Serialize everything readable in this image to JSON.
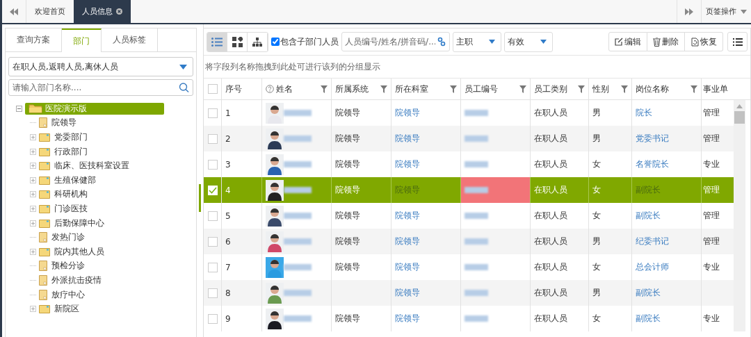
{
  "page_tabs": [
    {
      "label": "欢迎首页",
      "selected": false,
      "closable": false
    },
    {
      "label": "人员信息",
      "selected": true,
      "closable": true
    }
  ],
  "tab_actions": "页签操作",
  "left_panel": {
    "tabs": [
      {
        "label": "查询方案",
        "selected": false
      },
      {
        "label": "部门",
        "selected": true
      },
      {
        "label": "人员标签",
        "selected": false
      }
    ],
    "status_filter": "在职人员,返聘人员,离休人员",
    "search": {
      "placeholder": "请输入部门名称...."
    },
    "tree": [
      {
        "label": "医院演示版",
        "kind": "folder",
        "expanded": true,
        "selected": true,
        "children": [
          {
            "label": "院领导",
            "kind": "leaf",
            "selected": false
          },
          {
            "label": "党委部门",
            "kind": "folder",
            "expanded": false,
            "selected": false
          },
          {
            "label": "行政部门",
            "kind": "folder",
            "expanded": false,
            "selected": false
          },
          {
            "label": "临床、医技科室设置",
            "kind": "folder",
            "expanded": false,
            "selected": false
          },
          {
            "label": "生殖保健部",
            "kind": "folder",
            "expanded": false,
            "selected": false
          },
          {
            "label": "科研机构",
            "kind": "folder",
            "expanded": false,
            "selected": false
          },
          {
            "label": "门诊医技",
            "kind": "folder",
            "expanded": false,
            "selected": false
          },
          {
            "label": "后勤保障中心",
            "kind": "folder",
            "expanded": false,
            "selected": false
          },
          {
            "label": "发热门诊",
            "kind": "leaf",
            "selected": false
          },
          {
            "label": "院内其他人员",
            "kind": "folder",
            "expanded": false,
            "selected": false
          },
          {
            "label": "预检分诊",
            "kind": "leaf",
            "selected": false
          },
          {
            "label": "外派抗击疫情",
            "kind": "leaf",
            "selected": false
          },
          {
            "label": "放疗中心",
            "kind": "leaf",
            "selected": false
          },
          {
            "label": "新院区",
            "kind": "folder",
            "expanded": false,
            "selected": false
          }
        ]
      }
    ]
  },
  "toolbar": {
    "views": [
      {
        "kind": "list",
        "selected": true
      },
      {
        "kind": "cards",
        "selected": false
      },
      {
        "kind": "org",
        "selected": false
      }
    ],
    "include_sub": {
      "label": "包含子部门人员",
      "checked": true
    },
    "search": {
      "placeholder": "人员编号/姓名/拼音码/..."
    },
    "position_filter": "主职",
    "validity_filter": "有效",
    "buttons": [
      {
        "kind": "edit",
        "label": "编辑"
      },
      {
        "kind": "delete",
        "label": "删除"
      },
      {
        "kind": "restore",
        "label": "恢复"
      }
    ]
  },
  "group_hint": "将字段列名称拖拽到此处可进行该列的分组显示",
  "table": {
    "columns": [
      {
        "label": "序号",
        "filter": false,
        "help": false
      },
      {
        "label": "姓名",
        "filter": true,
        "help": true
      },
      {
        "label": "所属系统",
        "filter": true,
        "help": false
      },
      {
        "label": "所在科室",
        "filter": true,
        "help": false
      },
      {
        "label": "员工编号",
        "filter": true,
        "help": false
      },
      {
        "label": "员工类别",
        "filter": true,
        "help": false
      },
      {
        "label": "性别",
        "filter": true,
        "help": false
      },
      {
        "label": "岗位名称",
        "filter": true,
        "help": false
      },
      {
        "label": "事业单",
        "filter": false,
        "help": false
      }
    ],
    "select_all": false,
    "rows": [
      {
        "no": "1",
        "system": "院领导",
        "dept": "院领导",
        "type": "在职人员",
        "gender": "男",
        "post": "院长",
        "unit": "管理",
        "checked": false,
        "selected": false,
        "cell_flagged": false
      },
      {
        "no": "2",
        "system": "院领导",
        "dept": "院领导",
        "type": "在职人员",
        "gender": "男",
        "post": "党委书记",
        "unit": "管理",
        "checked": false,
        "selected": false,
        "cell_flagged": false
      },
      {
        "no": "3",
        "system": "院领导",
        "dept": "院领导",
        "type": "在职人员",
        "gender": "女",
        "post": "名誉院长",
        "unit": "专业",
        "checked": false,
        "selected": false,
        "cell_flagged": false
      },
      {
        "no": "4",
        "system": "院领导",
        "dept": "院领导",
        "type": "在职人员",
        "gender": "女",
        "post": "副院长",
        "unit": "管理",
        "checked": true,
        "selected": true,
        "cell_flagged": true
      },
      {
        "no": "5",
        "system": "院领导",
        "dept": "院领导",
        "type": "在职人员",
        "gender": "女",
        "post": "副院长",
        "unit": "管理",
        "checked": false,
        "selected": false,
        "cell_flagged": false
      },
      {
        "no": "6",
        "system": "院领导",
        "dept": "院领导",
        "type": "在职人员",
        "gender": "男",
        "post": "纪委书记",
        "unit": "管理",
        "checked": false,
        "selected": false,
        "cell_flagged": false
      },
      {
        "no": "7",
        "system": "院领导",
        "dept": "院领导",
        "type": "在职人员",
        "gender": "女",
        "post": "总会计师",
        "unit": "专业",
        "checked": false,
        "selected": false,
        "cell_flagged": false
      },
      {
        "no": "8",
        "dept": "院领导",
        "type": "在职人员",
        "gender": "男",
        "post": "副院长",
        "checked": false,
        "selected": false,
        "cell_flagged": false
      },
      {
        "no": "9",
        "system": "院领导",
        "dept": "院领导",
        "type": "在职人员",
        "gender": "女",
        "post": "副院长",
        "unit": "专业",
        "checked": false,
        "selected": false,
        "cell_flagged": false
      }
    ]
  }
}
